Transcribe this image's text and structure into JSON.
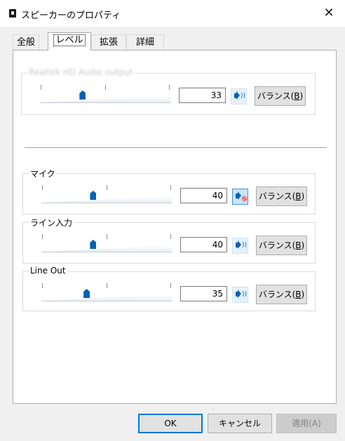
{
  "window": {
    "title": "スピーカーのプロパティ",
    "close_glyph": "✕"
  },
  "tabs": [
    {
      "label": "全般",
      "active": false
    },
    {
      "label": "レベル",
      "active": true
    },
    {
      "label": "拡張",
      "active": false
    },
    {
      "label": "詳細",
      "active": false
    }
  ],
  "levels": [
    {
      "label": "Realtek HD Audio output",
      "value": "33",
      "level_percent": 33,
      "muted": false,
      "balance_label": "バランス(B)",
      "balance_accel": "B"
    },
    {
      "label": "マイク",
      "value": "40",
      "level_percent": 40,
      "muted": true,
      "balance_label": "バランス(B)",
      "balance_accel": "B"
    },
    {
      "label": "ライン入力",
      "value": "40",
      "level_percent": 40,
      "muted": false,
      "balance_label": "バランス(B)",
      "balance_accel": "B"
    },
    {
      "label": "Line Out",
      "value": "35",
      "level_percent": 35,
      "muted": false,
      "balance_label": "バランス(B)",
      "balance_accel": "B"
    }
  ],
  "buttons": {
    "ok": "OK",
    "cancel": "キャンセル",
    "apply": "適用(A)",
    "apply_enabled": false
  },
  "colors": {
    "accent": "#0063b1",
    "focus_border": "#0078d7",
    "muted_badge": "#e03a3a"
  },
  "icons": {
    "speaker": "speaker-icon",
    "muted_speaker": "speaker-muted-icon",
    "close": "close-icon"
  }
}
